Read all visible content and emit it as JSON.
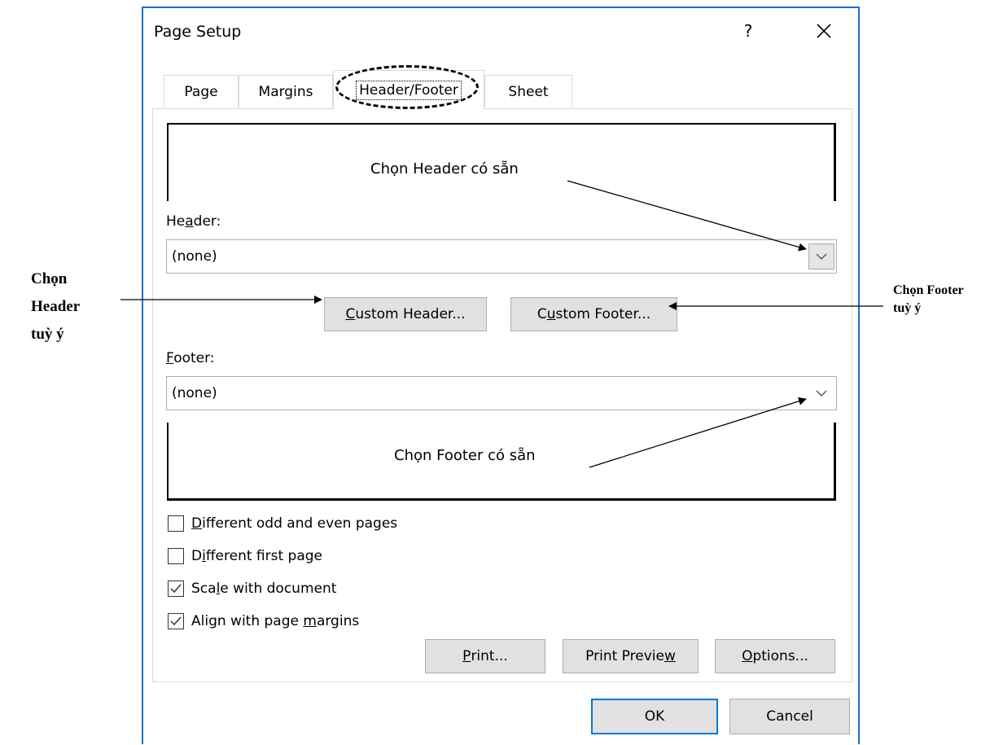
{
  "dialog": {
    "title": "Page Setup",
    "help_label": "?",
    "tabs": [
      {
        "label": "Page",
        "selected": false
      },
      {
        "label": "Margins",
        "selected": false
      },
      {
        "label": "Header/Footer",
        "selected": true
      },
      {
        "label": "Sheet",
        "selected": false
      }
    ],
    "header": {
      "label_pre": "He",
      "label_key": "a",
      "label_post": "der:",
      "value": "(none)"
    },
    "custom_header": {
      "key": "C",
      "rest": "ustom Header..."
    },
    "custom_footer": {
      "pre": "C",
      "key": "u",
      "rest": "stom Footer..."
    },
    "footer": {
      "label_key": "F",
      "label_post": "ooter:",
      "value": "(none)"
    },
    "checkboxes": [
      {
        "pre": "",
        "key": "D",
        "post": "ifferent odd and even pages",
        "checked": false
      },
      {
        "pre": "D",
        "key": "i",
        "post": "fferent first page",
        "checked": false
      },
      {
        "pre": "Sca",
        "key": "l",
        "post": "e with document",
        "checked": true
      },
      {
        "pre": "Align with page ",
        "key": "m",
        "post": "argins",
        "checked": true
      }
    ],
    "buttons": {
      "print": {
        "key": "P",
        "rest": "rint..."
      },
      "print_preview": {
        "pre": "Print Previe",
        "key": "w"
      },
      "options": {
        "key": "O",
        "rest": "ptions..."
      },
      "ok": "OK",
      "cancel": "Cancel"
    }
  },
  "annotations": {
    "header_preset": "Chọn Header có sẵn",
    "footer_preset": "Chọn Footer có sẵn",
    "custom_header": [
      "Chọn",
      "Header",
      "tuỳ ý"
    ],
    "custom_footer": [
      "Chọn Footer",
      "tuỳ ý"
    ]
  }
}
